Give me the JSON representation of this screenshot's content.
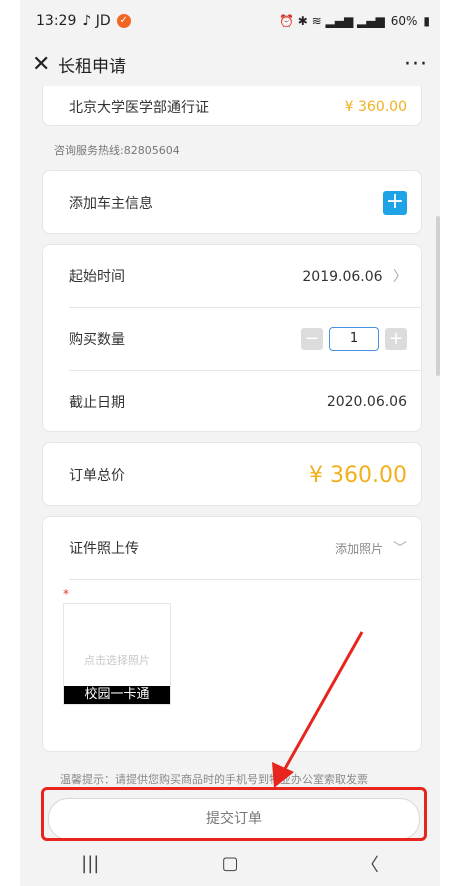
{
  "status": {
    "time": "13:29",
    "left_icons": "♪ JD",
    "battery": "60%"
  },
  "titlebar": {
    "title": "长租申请"
  },
  "product": {
    "name": "北京大学医学部通行证",
    "price": "¥ 360.00"
  },
  "hotline": "咨询服务热线:82805604",
  "owner": {
    "label": "添加车主信息"
  },
  "details": {
    "start_label": "起始时间",
    "start_value": "2019.06.06",
    "qty_label": "购买数量",
    "qty_value": "1",
    "end_label": "截止日期",
    "end_value": "2020.06.06"
  },
  "total": {
    "label": "订单总价",
    "value": "¥ 360.00"
  },
  "upload": {
    "label": "证件照上传",
    "add_photo": "添加照片",
    "hint": "点击选择照片",
    "card_label": "校园一卡通"
  },
  "tip": "温馨提示：请提供您购买商品时的手机号到物业办公室索取发票",
  "submit_label": "提交订单",
  "colors": {
    "accent": "#1ea3e6",
    "price": "#f2b01e",
    "annotation": "#e8241f"
  }
}
